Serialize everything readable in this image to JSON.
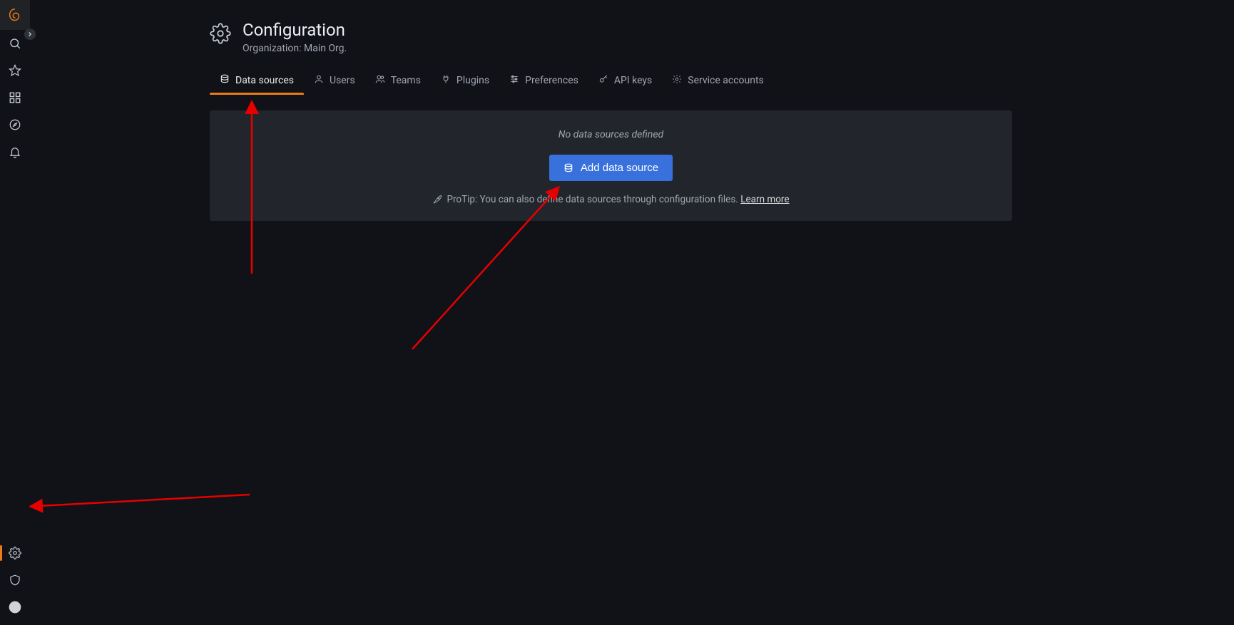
{
  "sidebar": {
    "items_top": [
      {
        "name": "logo",
        "icon": "grafana-logo"
      },
      {
        "name": "search",
        "icon": "search-icon"
      },
      {
        "name": "starred",
        "icon": "star-icon"
      },
      {
        "name": "dashboards",
        "icon": "grid-icon"
      },
      {
        "name": "explore",
        "icon": "compass-icon"
      },
      {
        "name": "alerting",
        "icon": "bell-icon"
      }
    ],
    "items_bottom": [
      {
        "name": "configuration",
        "icon": "gear-icon",
        "active": true
      },
      {
        "name": "admin",
        "icon": "shield-icon"
      },
      {
        "name": "account",
        "icon": "avatar-icon"
      }
    ]
  },
  "header": {
    "title": "Configuration",
    "subtitle": "Organization: Main Org."
  },
  "tabs": [
    {
      "icon": "database-icon",
      "label": "Data sources",
      "active": true
    },
    {
      "icon": "user-icon",
      "label": "Users",
      "active": false
    },
    {
      "icon": "users-icon",
      "label": "Teams",
      "active": false
    },
    {
      "icon": "plug-icon",
      "label": "Plugins",
      "active": false
    },
    {
      "icon": "sliders-icon",
      "label": "Preferences",
      "active": false
    },
    {
      "icon": "key-icon",
      "label": "API keys",
      "active": false
    },
    {
      "icon": "gear-small-icon",
      "label": "Service accounts",
      "active": false
    }
  ],
  "panel": {
    "empty_message": "No data sources defined",
    "add_button_label": "Add data source",
    "protip_prefix": "ProTip: You can also define data sources through configuration files. ",
    "protip_link": "Learn more"
  }
}
